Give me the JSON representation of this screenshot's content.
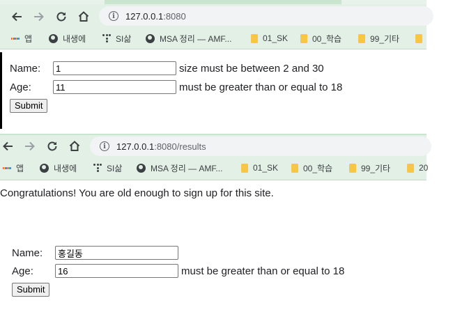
{
  "browser1": {
    "url_host": "127.0.0.1",
    "url_rest": ":8080",
    "bookmarks": [
      {
        "label": "앱",
        "icon": "apps-grid-icon"
      },
      {
        "label": "내생에",
        "icon": "globe-icon"
      },
      {
        "label": "SI삶",
        "icon": "dots-icon"
      },
      {
        "label": "MSA 정리 — AMF...",
        "icon": "globe-icon"
      },
      {
        "label": "01_SK",
        "icon": "folder-icon"
      },
      {
        "label": "00_학습",
        "icon": "folder-icon"
      },
      {
        "label": "99_기타",
        "icon": "folder-icon"
      }
    ]
  },
  "form1": {
    "name_label": "Name:",
    "name_value": "1",
    "name_error": "size must be between 2 and 30",
    "age_label": "Age:",
    "age_value": "11",
    "age_error": "must be greater than or equal to 18",
    "submit_label": "Submit"
  },
  "browser2": {
    "url_host": "127.0.0.1",
    "url_rest": ":8080/results",
    "bookmarks": [
      {
        "label": "앱",
        "icon": "apps-grid-icon"
      },
      {
        "label": "내생에",
        "icon": "globe-icon"
      },
      {
        "label": "SI삶",
        "icon": "dots-icon"
      },
      {
        "label": "MSA 정리 — AMF...",
        "icon": "globe-icon"
      },
      {
        "label": "01_SK",
        "icon": "folder-icon"
      },
      {
        "label": "00_학습",
        "icon": "folder-icon"
      },
      {
        "label": "99_기타",
        "icon": "folder-icon"
      },
      {
        "label": "20",
        "icon": "folder-icon"
      }
    ]
  },
  "results": {
    "message": "Congratulations! You are old enough to sign up for this site."
  },
  "form2": {
    "name_label": "Name:",
    "name_value": "홍길동",
    "age_label": "Age:",
    "age_value": "16",
    "age_error": "must be greater than or equal to 18",
    "submit_label": "Submit"
  },
  "colors": {
    "chrome_toolbar": "#e3f0e6",
    "omnibox": "#f1f3f4",
    "folder": "#f6c644"
  }
}
